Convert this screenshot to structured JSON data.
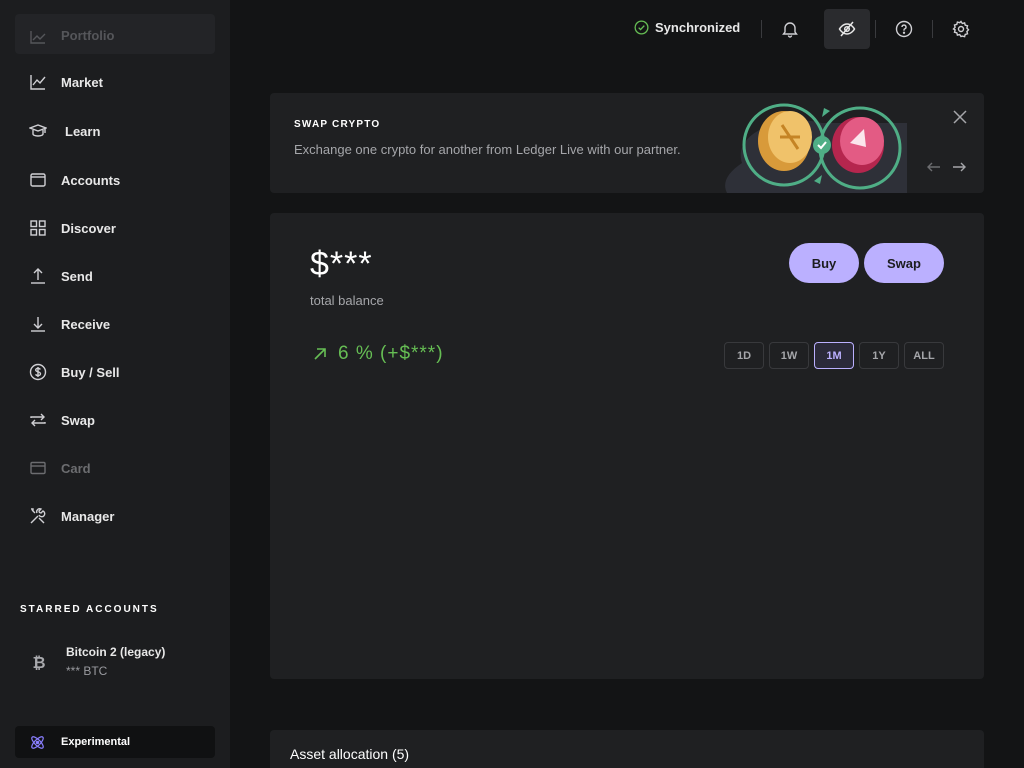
{
  "sidebar": {
    "items": [
      {
        "label": "Portfolio",
        "icon": "portfolio-icon"
      },
      {
        "label": "Market",
        "icon": "chart-line-icon"
      },
      {
        "label": "Learn",
        "icon": "graduation-cap-icon"
      },
      {
        "label": "Accounts",
        "icon": "wallet-icon"
      },
      {
        "label": "Discover",
        "icon": "grid-icon"
      },
      {
        "label": "Send",
        "icon": "arrow-up-icon"
      },
      {
        "label": "Receive",
        "icon": "arrow-down-icon"
      },
      {
        "label": "Buy / Sell",
        "icon": "dollar-circle-icon"
      },
      {
        "label": "Swap",
        "icon": "swap-arrows-icon"
      },
      {
        "label": "Card",
        "icon": "card-icon"
      },
      {
        "label": "Manager",
        "icon": "tools-icon"
      }
    ],
    "starred_title": "STARRED ACCOUNTS",
    "starred_account": {
      "name": "Bitcoin 2 (legacy)",
      "balance": "*** BTC",
      "currency_symbol": "₿"
    },
    "experimental_label": "Experimental"
  },
  "topbar": {
    "sync_label": "Synchronized"
  },
  "banner": {
    "title": "SWAP CRYPTO",
    "description": "Exchange one crypto for another from Ledger Live with our partner."
  },
  "balance": {
    "value": "$***",
    "label": "total balance",
    "change": "6 % (+$***)",
    "buy_label": "Buy",
    "swap_label": "Swap",
    "ranges": [
      "1D",
      "1W",
      "1M",
      "1Y",
      "ALL"
    ],
    "selected_range": "1M"
  },
  "allocation": {
    "title": "Asset allocation (5)"
  },
  "colors": {
    "accent": "#bbb0ff",
    "positive": "#66be54",
    "background": "#131415",
    "panel": "#1f2022"
  }
}
